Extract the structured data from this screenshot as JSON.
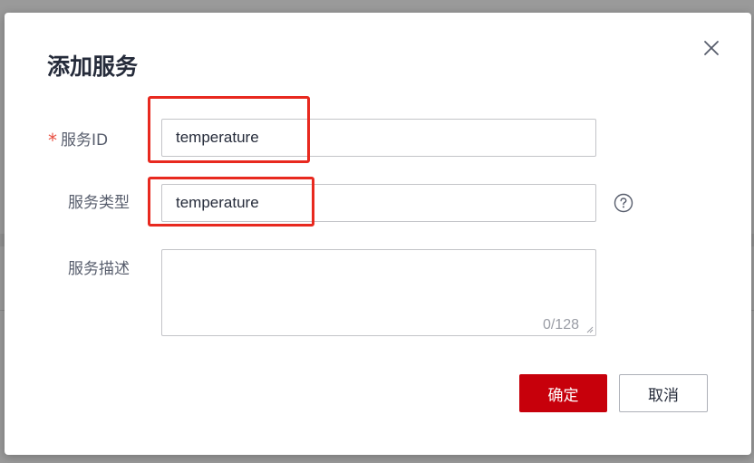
{
  "dialog": {
    "title": "添加服务",
    "close_icon": "close-icon"
  },
  "form": {
    "service_id": {
      "required_mark": "*",
      "label": "服务ID",
      "value": "temperature"
    },
    "service_type": {
      "label": "服务类型",
      "value": "temperature",
      "help_icon": "question-circle-icon"
    },
    "service_description": {
      "label": "服务描述",
      "value": "",
      "char_count": "0/128"
    }
  },
  "buttons": {
    "confirm_label": "确定",
    "cancel_label": "取消"
  },
  "colors": {
    "primary": "#c7000b",
    "highlight": "#e8291f",
    "required": "#e84e40"
  }
}
